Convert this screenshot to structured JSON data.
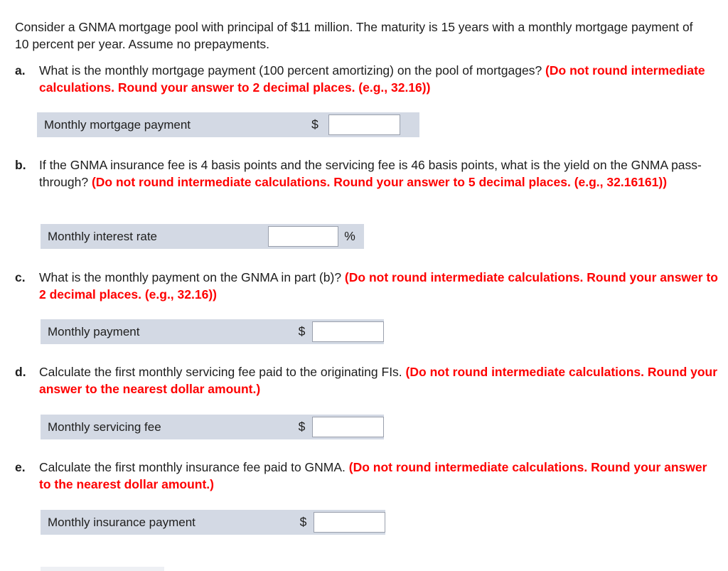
{
  "intro": {
    "text": "Consider a GNMA mortgage pool with principal of $11 million. The maturity is 15 years with a monthly mortgage payment of 10 percent per year. Assume no prepayments."
  },
  "questions": [
    {
      "marker": "a.",
      "prompt": "What is the monthly mortgage payment (100 percent amortizing) on the pool of mortgages? ",
      "instruction": "(Do not round intermediate calculations. Round your answer to 2 decimal places. (e.g., 32.16))",
      "answer": {
        "label": "Monthly mortgage payment",
        "symbol": "$",
        "symbol_position": "before",
        "value": "",
        "placeholder": ""
      }
    },
    {
      "marker": "b.",
      "prompt": "If the GNMA insurance fee is 4 basis points and the servicing fee is 46 basis points, what is the yield on the GNMA pass-through? ",
      "instruction": "(Do not round intermediate calculations. Round your answer to 5 decimal places. (e.g., 32.16161))",
      "answer": {
        "label": "Monthly interest rate",
        "symbol": "%",
        "symbol_position": "after",
        "value": "",
        "placeholder": ""
      }
    },
    {
      "marker": "c.",
      "prompt": "What is the monthly payment on the GNMA in part (b)? ",
      "instruction": "(Do not round intermediate calculations. Round your answer to 2 decimal places. (e.g., 32.16))",
      "answer": {
        "label": "Monthly payment",
        "symbol": "$",
        "symbol_position": "before",
        "value": "",
        "placeholder": ""
      }
    },
    {
      "marker": "d.",
      "prompt": "Calculate the first monthly servicing fee paid to the originating FIs. ",
      "instruction": "(Do not round intermediate calculations. Round your answer to the nearest dollar amount.)",
      "answer": {
        "label": "Monthly servicing fee",
        "symbol": "$",
        "symbol_position": "before",
        "value": "",
        "placeholder": ""
      }
    },
    {
      "marker": "e.",
      "prompt": "Calculate the first monthly insurance fee paid to GNMA. ",
      "instruction": "(Do not round intermediate calculations. Round your answer to the nearest dollar amount.)",
      "answer": {
        "label": "Monthly insurance payment",
        "symbol": "$",
        "symbol_position": "before",
        "value": "",
        "placeholder": ""
      }
    }
  ],
  "colors": {
    "instruction_red": "#fe0000",
    "row_background": "#d3d9e4",
    "input_border": "#9aa0ad",
    "text": "#1d1d1d",
    "page_background": "#ffffff"
  }
}
